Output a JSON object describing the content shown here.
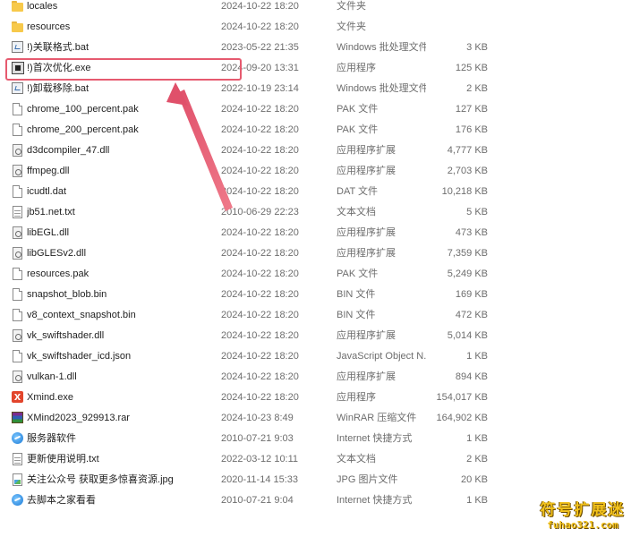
{
  "files": [
    {
      "name": "locales",
      "date": "2024-10-22 18:20",
      "type": "文件夹",
      "size": "",
      "icon": "folder-icon"
    },
    {
      "name": "resources",
      "date": "2024-10-22 18:20",
      "type": "文件夹",
      "size": "",
      "icon": "folder-icon"
    },
    {
      "name": "!)关联格式.bat",
      "date": "2023-05-22 21:35",
      "type": "Windows 批处理文件",
      "size": "3 KB",
      "icon": "batch-file-icon"
    },
    {
      "name": "!)首次优化.exe",
      "date": "2024-09-20 13:31",
      "type": "应用程序",
      "size": "125 KB",
      "icon": "application-icon"
    },
    {
      "name": "!)卸载移除.bat",
      "date": "2022-10-19 23:14",
      "type": "Windows 批处理文件",
      "size": "2 KB",
      "icon": "batch-file-icon"
    },
    {
      "name": "chrome_100_percent.pak",
      "date": "2024-10-22 18:20",
      "type": "PAK 文件",
      "size": "127 KB",
      "icon": "file-icon"
    },
    {
      "name": "chrome_200_percent.pak",
      "date": "2024-10-22 18:20",
      "type": "PAK 文件",
      "size": "176 KB",
      "icon": "file-icon"
    },
    {
      "name": "d3dcompiler_47.dll",
      "date": "2024-10-22 18:20",
      "type": "应用程序扩展",
      "size": "4,777 KB",
      "icon": "dll-file-icon"
    },
    {
      "name": "ffmpeg.dll",
      "date": "2024-10-22 18:20",
      "type": "应用程序扩展",
      "size": "2,703 KB",
      "icon": "dll-file-icon"
    },
    {
      "name": "icudtl.dat",
      "date": "2024-10-22 18:20",
      "type": "DAT 文件",
      "size": "10,218 KB",
      "icon": "file-icon"
    },
    {
      "name": "jb51.net.txt",
      "date": "2010-06-29 22:23",
      "type": "文本文档",
      "size": "5 KB",
      "icon": "text-file-icon"
    },
    {
      "name": "libEGL.dll",
      "date": "2024-10-22 18:20",
      "type": "应用程序扩展",
      "size": "473 KB",
      "icon": "dll-file-icon"
    },
    {
      "name": "libGLESv2.dll",
      "date": "2024-10-22 18:20",
      "type": "应用程序扩展",
      "size": "7,359 KB",
      "icon": "dll-file-icon"
    },
    {
      "name": "resources.pak",
      "date": "2024-10-22 18:20",
      "type": "PAK 文件",
      "size": "5,249 KB",
      "icon": "file-icon"
    },
    {
      "name": "snapshot_blob.bin",
      "date": "2024-10-22 18:20",
      "type": "BIN 文件",
      "size": "169 KB",
      "icon": "file-icon"
    },
    {
      "name": "v8_context_snapshot.bin",
      "date": "2024-10-22 18:20",
      "type": "BIN 文件",
      "size": "472 KB",
      "icon": "file-icon"
    },
    {
      "name": "vk_swiftshader.dll",
      "date": "2024-10-22 18:20",
      "type": "应用程序扩展",
      "size": "5,014 KB",
      "icon": "dll-file-icon"
    },
    {
      "name": "vk_swiftshader_icd.json",
      "date": "2024-10-22 18:20",
      "type": "JavaScript Object N...",
      "size": "1 KB",
      "icon": "file-icon"
    },
    {
      "name": "vulkan-1.dll",
      "date": "2024-10-22 18:20",
      "type": "应用程序扩展",
      "size": "894 KB",
      "icon": "dll-file-icon"
    },
    {
      "name": "Xmind.exe",
      "date": "2024-10-22 18:20",
      "type": "应用程序",
      "size": "154,017 KB",
      "icon": "xmind-app-icon"
    },
    {
      "name": "XMind2023_929913.rar",
      "date": "2024-10-23 8:49",
      "type": "WinRAR 压缩文件",
      "size": "164,902 KB",
      "icon": "rar-archive-icon"
    },
    {
      "name": "服务器软件",
      "date": "2010-07-21 9:03",
      "type": "Internet 快捷方式",
      "size": "1 KB",
      "icon": "internet-shortcut-icon"
    },
    {
      "name": "更新使用说明.txt",
      "date": "2022-03-12 10:11",
      "type": "文本文档",
      "size": "2 KB",
      "icon": "text-file-icon"
    },
    {
      "name": "关注公众号 获取更多惊喜资源.jpg",
      "date": "2020-11-14 15:33",
      "type": "JPG 图片文件",
      "size": "20 KB",
      "icon": "image-file-icon"
    },
    {
      "name": "去脚本之家看看",
      "date": "2010-07-21 9:04",
      "type": "Internet 快捷方式",
      "size": "1 KB",
      "icon": "internet-shortcut-icon"
    }
  ],
  "highlight_index": 3,
  "highlight_color": "#e65a6f",
  "watermark": {
    "title": "符号扩展迷",
    "url": "fuhao321.com"
  }
}
